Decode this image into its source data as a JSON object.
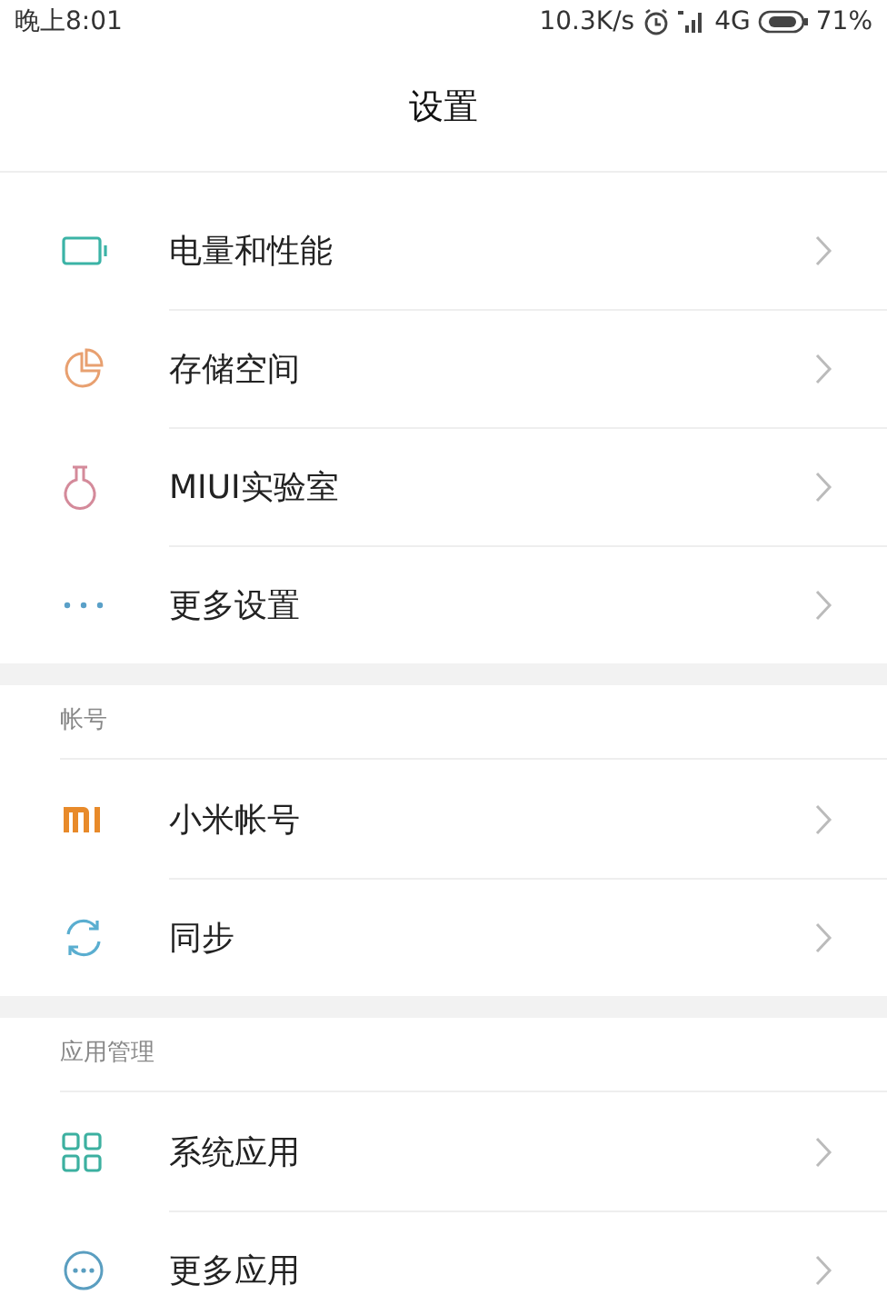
{
  "status_bar": {
    "time": "晚上8:01",
    "speed": "10.3K/s",
    "network": "4G",
    "battery": "71%"
  },
  "header": {
    "title": "设置"
  },
  "groups": [
    {
      "items": [
        {
          "label": "电量和性能"
        },
        {
          "label": "存储空间"
        },
        {
          "label": "MIUI实验室"
        },
        {
          "label": "更多设置"
        }
      ]
    },
    {
      "header": "帐号",
      "items": [
        {
          "label": "小米帐号"
        },
        {
          "label": "同步"
        }
      ]
    },
    {
      "header": "应用管理",
      "items": [
        {
          "label": "系统应用"
        },
        {
          "label": "更多应用"
        }
      ]
    }
  ]
}
